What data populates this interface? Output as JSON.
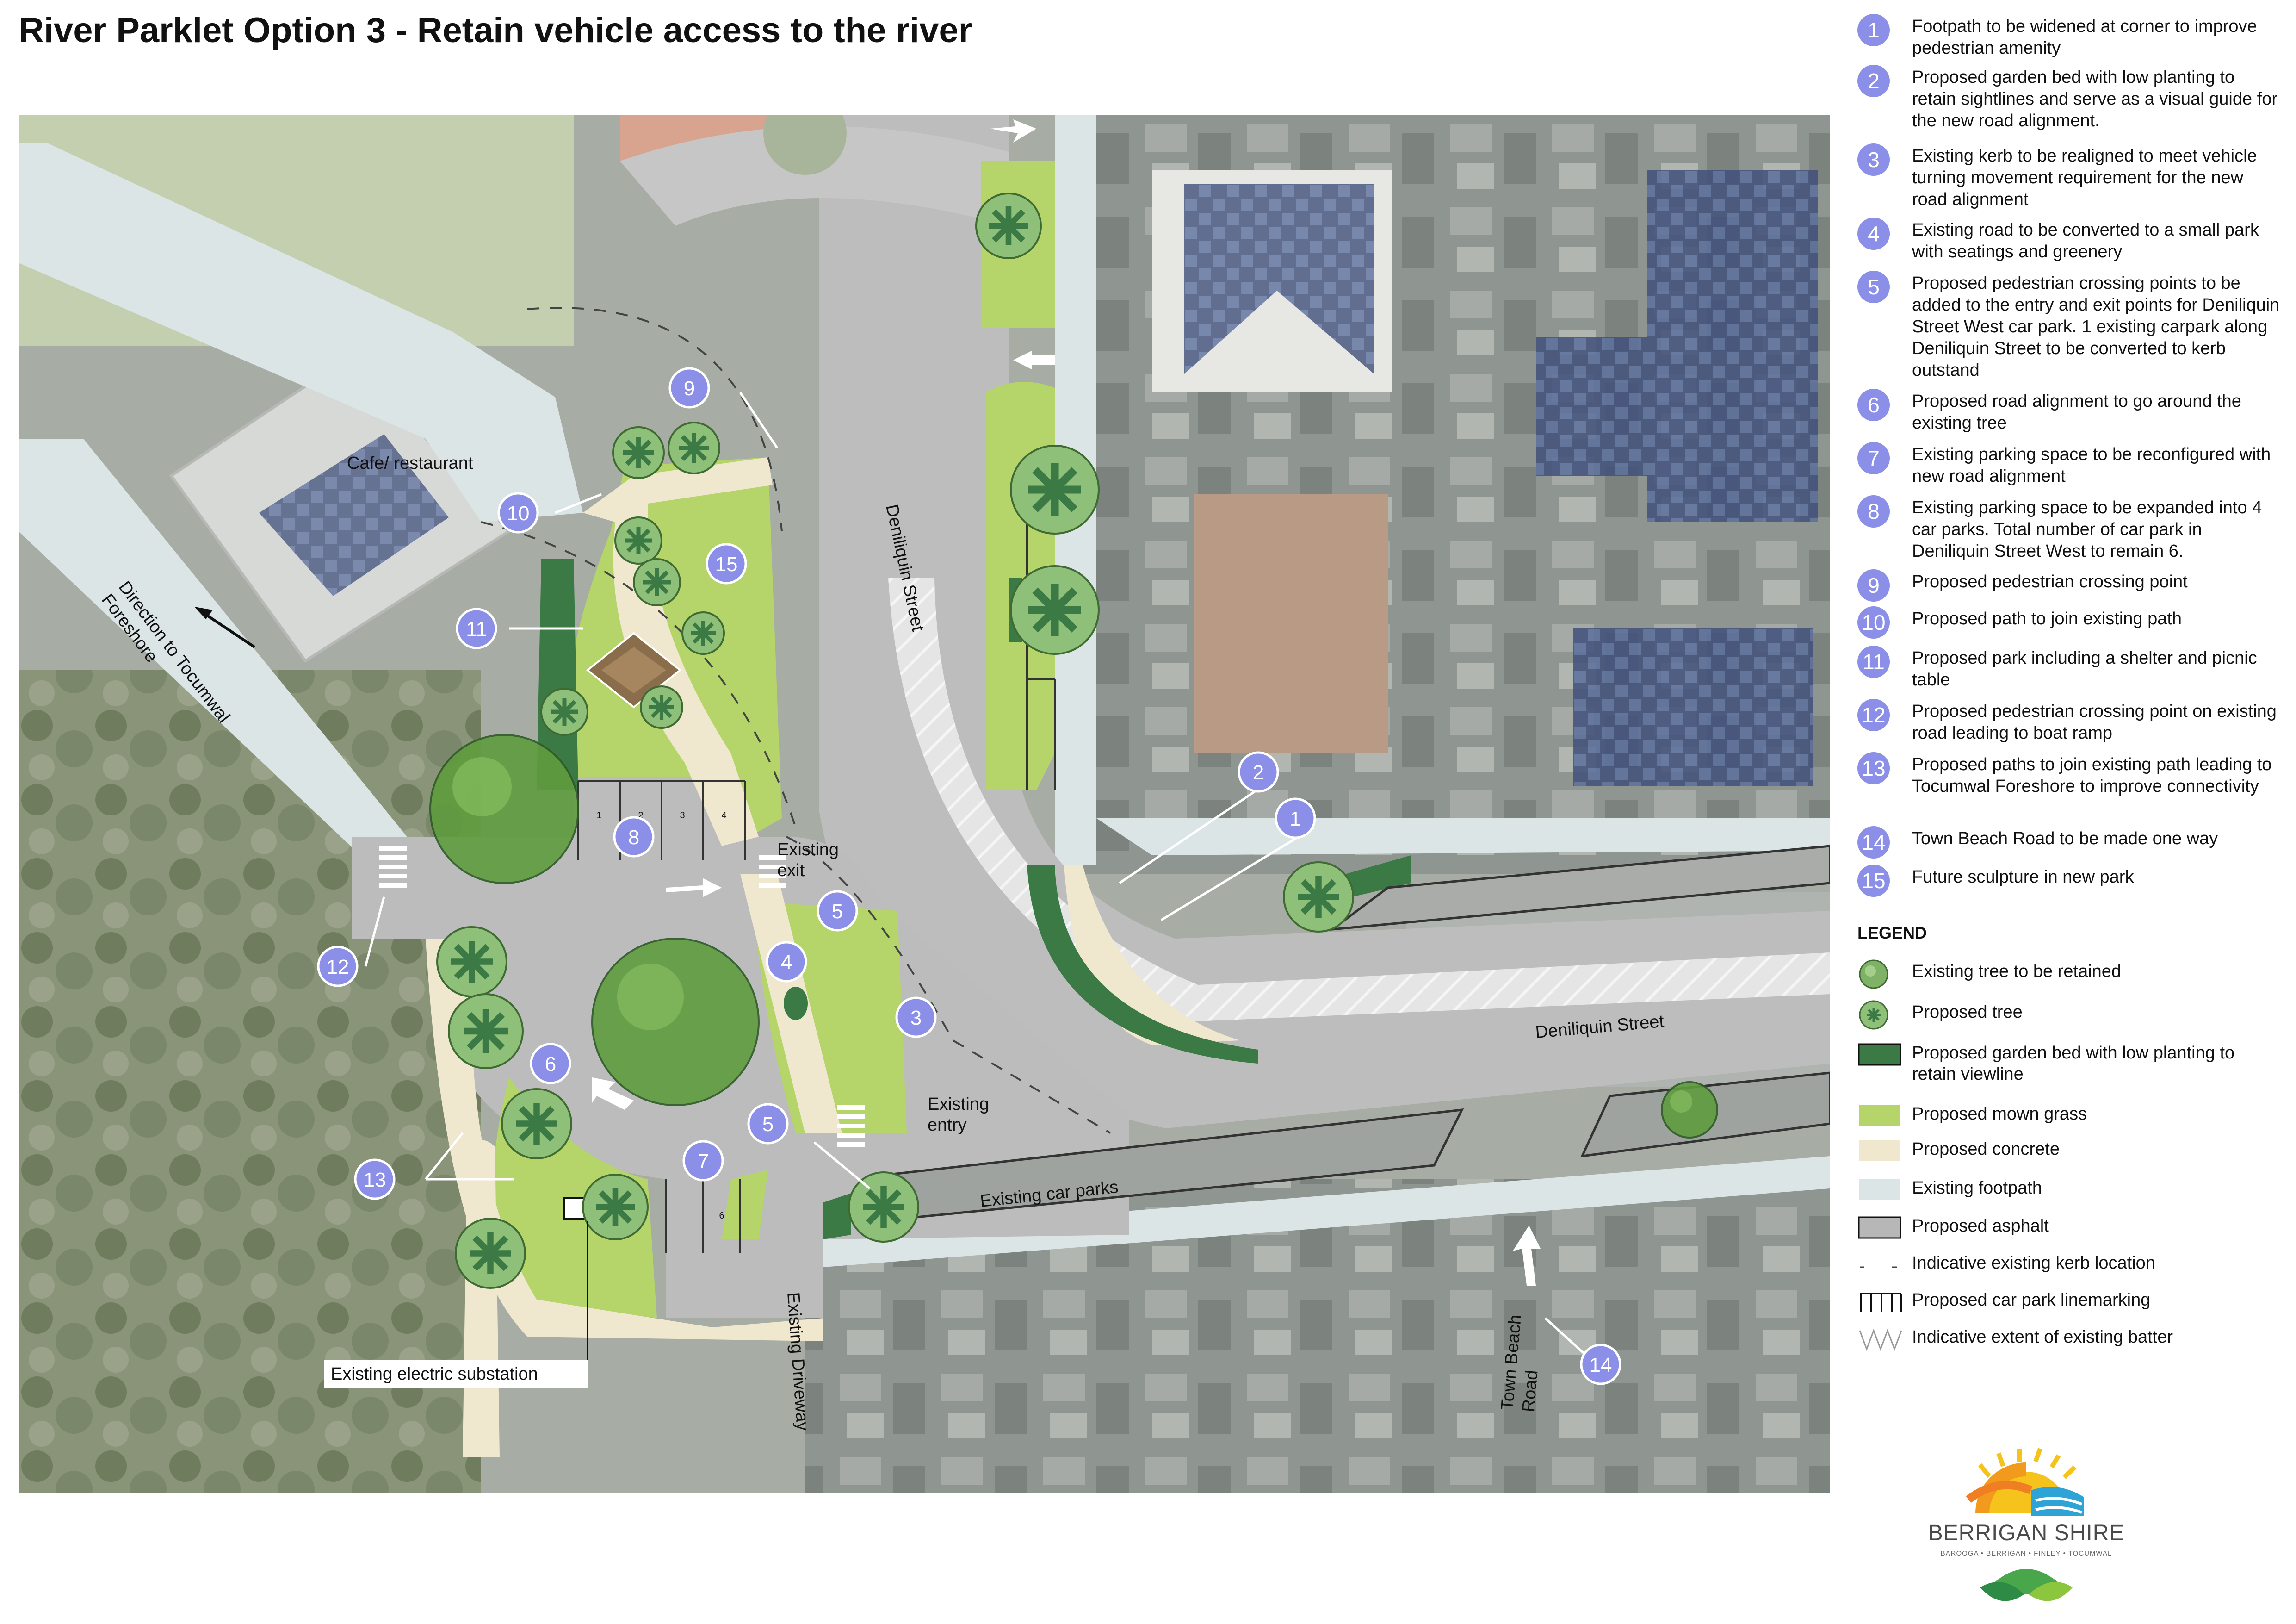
{
  "title": "River Parklet Option 3 - Retain vehicle access to the river",
  "notes": [
    {
      "num": "1",
      "text": "Footpath to be widened at corner to improve pedestrian amenity"
    },
    {
      "num": "2",
      "text": "Proposed garden bed with low planting to retain sightlines and serve as a visual guide for the new road alignment."
    },
    {
      "num": "3",
      "text": "Existing kerb to be realigned to meet vehicle turning movement requirement for the new road alignment"
    },
    {
      "num": "4",
      "text": "Existing road to be converted to a small park with seatings and greenery"
    },
    {
      "num": "5",
      "text": "Proposed pedestrian crossing points to be added to the entry and exit points for Deniliquin Street West car park. 1 existing carpark along Deniliquin Street to be converted to kerb outstand"
    },
    {
      "num": "6",
      "text": "Proposed road alignment to go around the existing tree"
    },
    {
      "num": "7",
      "text": "Existing parking space to be reconfigured with new road alignment"
    },
    {
      "num": "8",
      "text": "Existing parking space to be expanded into 4 car parks. Total number of car park in Deniliquin Street West to remain 6."
    },
    {
      "num": "9",
      "text": "Proposed pedestrian crossing point"
    },
    {
      "num": "10",
      "text": "Proposed path to join existing path"
    },
    {
      "num": "11",
      "text": "Proposed park including a shelter and picnic table"
    },
    {
      "num": "12",
      "text": "Proposed pedestrian crossing point on existing road leading to boat ramp"
    },
    {
      "num": "13",
      "text": "Proposed paths to join existing path leading to Tocumwal Foreshore to improve connectivity"
    },
    {
      "num": "14",
      "text": "Town Beach Road to be made one way"
    },
    {
      "num": "15",
      "text": "Future sculpture in new park"
    }
  ],
  "legend": {
    "heading": "LEGEND",
    "items": [
      {
        "label": "Existing tree to be retained",
        "icon": "existing-tree"
      },
      {
        "label": "Proposed tree",
        "icon": "proposed-tree"
      },
      {
        "label": "Proposed garden bed with low planting to retain viewline",
        "icon": "swatch",
        "color": "#3b7a45"
      },
      {
        "label": "Proposed mown grass",
        "icon": "swatch",
        "color": "#b5d56a"
      },
      {
        "label": "Proposed concrete",
        "icon": "swatch",
        "color": "#efe8cf"
      },
      {
        "label": "Existing footpath",
        "icon": "swatch",
        "color": "#dce5e6"
      },
      {
        "label": "Proposed asphalt",
        "icon": "swatch",
        "color": "#b7b7b7"
      },
      {
        "label": "Indicative existing kerb location",
        "icon": "dashed-line"
      },
      {
        "label": "Proposed car park linemarking",
        "icon": "linemarking"
      },
      {
        "label": "Indicative extent of existing batter",
        "icon": "batter"
      }
    ]
  },
  "map_labels": {
    "cafe": "Cafe/ restaurant",
    "direction_line1": "Direction to Tocumwal",
    "direction_line2": "Foreshore",
    "deniliquin_vertical": "Deniliquin Street",
    "deniliquin_horizontal": "Deniliquin Street",
    "existing_exit_line1": "Existing",
    "existing_exit_line2": "exit",
    "existing_entry_line1": "Existing",
    "existing_entry_line2": "entry",
    "existing_car_parks": "Existing car parks",
    "existing_driveway": "Existing  Driveway",
    "substation": "Existing electric substation",
    "town_beach_line1": "Town Beach",
    "town_beach_line2": "Road",
    "parking_numbers": [
      "1",
      "2",
      "3",
      "4"
    ],
    "parking_number_lower": "6"
  },
  "map_markers": [
    "1",
    "2",
    "3",
    "4",
    "5",
    "5",
    "6",
    "7",
    "8",
    "9",
    "10",
    "11",
    "12",
    "13",
    "14",
    "15"
  ],
  "logo": {
    "name": "BERRIGAN SHIRE",
    "towns": "BAROOGA • BERRIGAN • FINLEY • TOCUMWAL"
  },
  "colors": {
    "marker": "#8b8fe8",
    "garden_bed": "#3b7a45",
    "grass": "#b5d56a",
    "concrete": "#efe8cf",
    "footpath": "#dce5e6",
    "asphalt": "#b7b7b7",
    "tree": "#5f9c3e"
  }
}
